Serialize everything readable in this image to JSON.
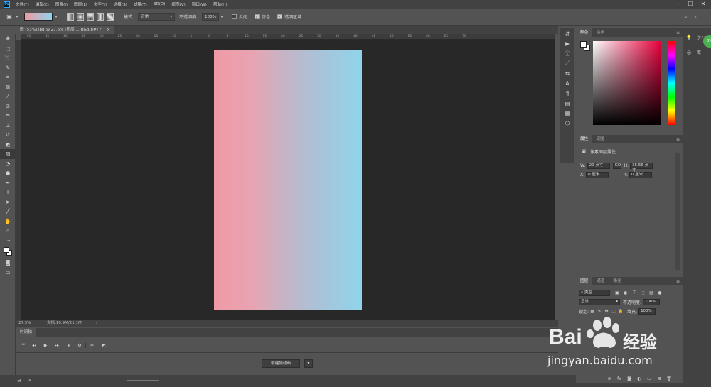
{
  "menubar": {
    "app_icon": "Ps",
    "items": [
      "文件(F)",
      "编辑(E)",
      "图像(I)",
      "图层(L)",
      "文字(Y)",
      "选择(S)",
      "滤镜(T)",
      "3D(D)",
      "视图(V)",
      "窗口(W)",
      "帮助(H)"
    ]
  },
  "options": {
    "mode_label": "模式：",
    "mode_value": "正常",
    "opacity_label": "不透明度：",
    "opacity_value": "100%",
    "reverse_label": "反向",
    "dither_label": "仿色",
    "transparency_label": "透明区域",
    "gradient_colors": [
      "#ef9aa6",
      "#8fd5ea"
    ]
  },
  "document": {
    "tab_title": "图 (53%).jpg @ 27.5% (图层 1, RGB/8#) *",
    "zoom": "27.5%",
    "doc_size": "文档:10.9M/21.1M",
    "gradient_start": "#ef99a5",
    "gradient_end": "#8ed5ea"
  },
  "rulers": {
    "top": [
      "50",
      "45",
      "40",
      "35",
      "30",
      "25",
      "20",
      "15",
      "10",
      "5",
      "0",
      "5",
      "10",
      "15",
      "20",
      "25",
      "30",
      "35",
      "40",
      "45",
      "50",
      "55",
      "60",
      "65",
      "70"
    ]
  },
  "timeline": {
    "tab_label": "时间轴",
    "create_button": "创建帧动画"
  },
  "color_panel": {
    "tabs": [
      "颜色",
      "色板"
    ]
  },
  "props_panel": {
    "tabs": [
      "属性",
      "调整"
    ],
    "title": "像素图层属性",
    "w_label": "W:",
    "w_value": "20 英寸",
    "go_label": "GO",
    "h_label": "H:",
    "h_value": "35.56 英寸",
    "x_label": "X:",
    "x_value": "0 厘米",
    "y_label": "Y:",
    "y_value": "0 厘米"
  },
  "layers_panel": {
    "tabs": [
      "图层",
      "通道",
      "路径"
    ],
    "kind_filter": "类型",
    "blend_mode": "正常",
    "opacity_label": "不透明度:",
    "opacity_value": "100%",
    "lock_label": "锁定:",
    "fill_label": "填充:",
    "fill_value": "100%"
  },
  "far_right": {
    "learn_label": "学习",
    "library_label": "库",
    "badge": "3%"
  },
  "watermark": {
    "brand_a": "Bai",
    "brand_b": "经验",
    "url": "jingyan.baidu.com"
  }
}
